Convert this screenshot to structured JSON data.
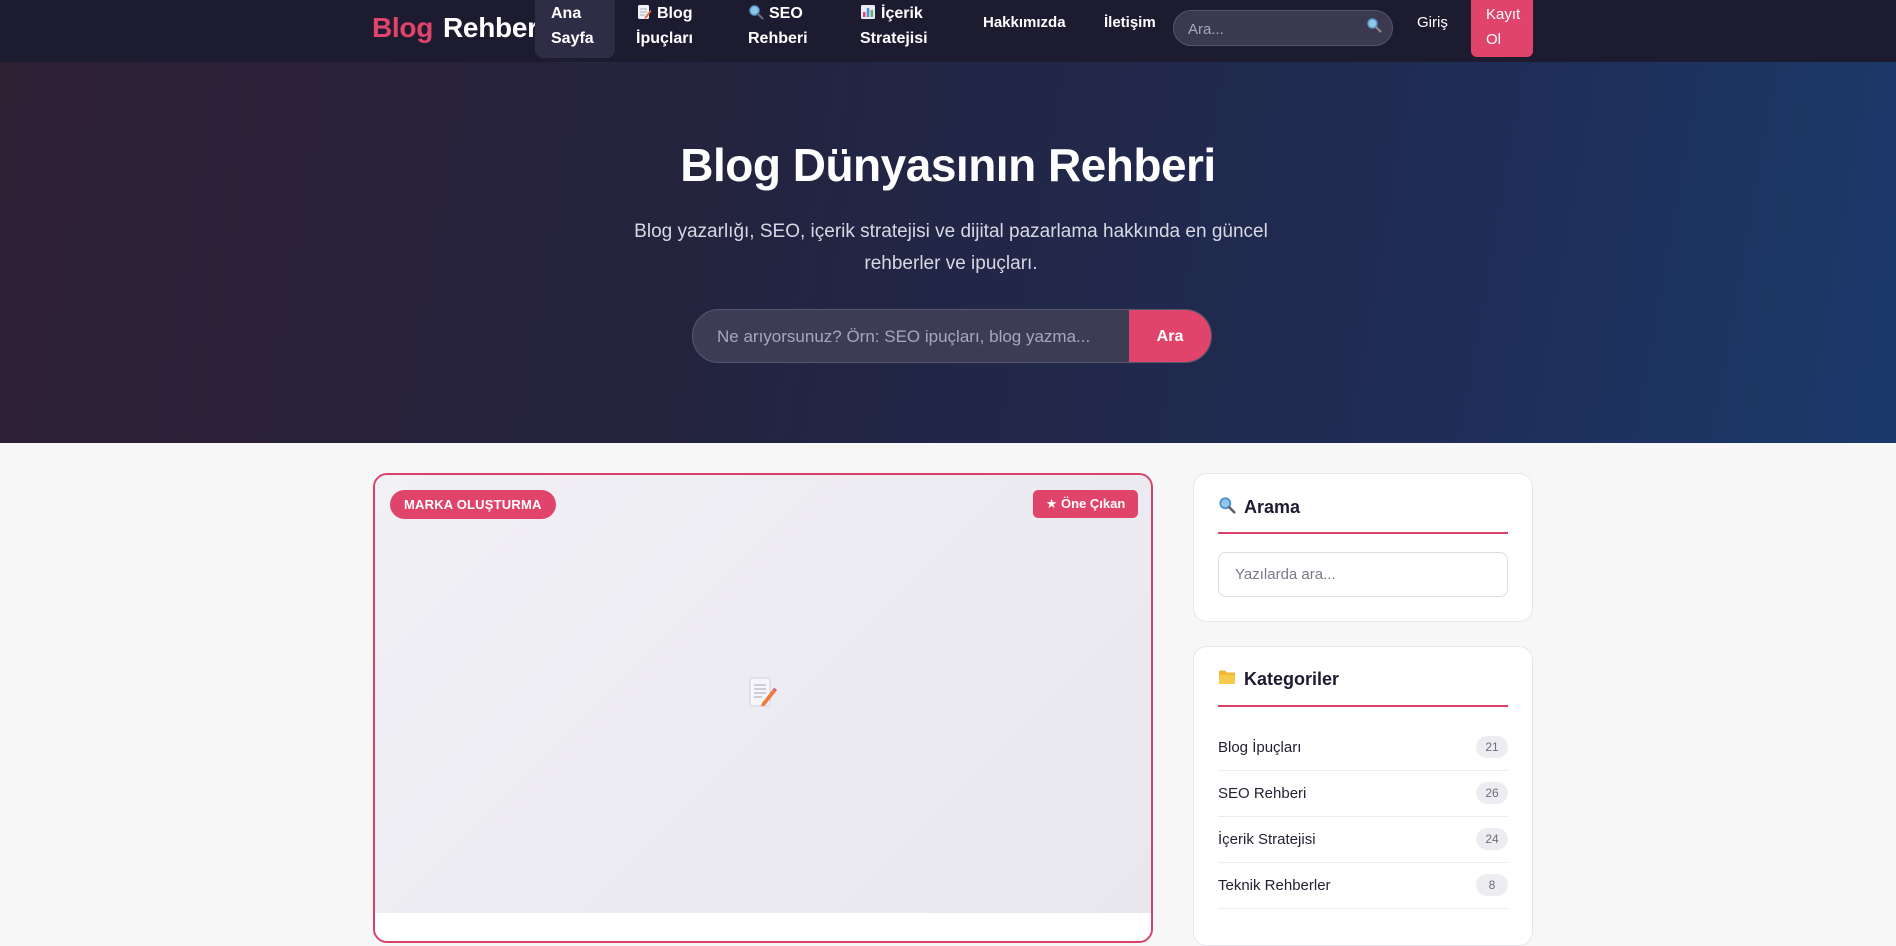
{
  "nav": {
    "logo_part1": "Blog",
    "logo_part2": "Rehberi",
    "items": [
      {
        "line1": "Ana",
        "line2": "Sayfa",
        "icon": ""
      },
      {
        "line1": "Blog",
        "line2": "İpuçları",
        "icon": "memo-icon"
      },
      {
        "line1": "SEO",
        "line2": "Rehberi",
        "icon": "magnifier-icon"
      },
      {
        "line1": "İçerik",
        "line2": "Stratejisi",
        "icon": "bar-chart-icon"
      }
    ],
    "about": "Hakkımızda",
    "contact": "İletişim",
    "search_placeholder": "Ara...",
    "login": "Giriş",
    "signup_line1": "Kayıt",
    "signup_line2": "Ol"
  },
  "hero": {
    "title": "Blog Dünyasının Rehberi",
    "subtitle": "Blog yazarlığı, SEO, içerik stratejisi ve dijital pazarlama hakkında en güncel rehberler ve ipuçları.",
    "search_placeholder": "Ne arıyorsunuz? Örn: SEO ipuçları, blog yazma...",
    "search_button": "Ara"
  },
  "featured": {
    "category": "MARKA OLUŞTURMA",
    "badge": "★ Öne Çıkan",
    "image_icon": "memo-icon"
  },
  "sidebar": {
    "search": {
      "title": "Arama",
      "icon": "magnifier-icon",
      "placeholder": "Yazılarda ara..."
    },
    "categories": {
      "title": "Kategoriler",
      "icon": "folder-icon",
      "items": [
        {
          "label": "Blog İpuçları",
          "count": "21"
        },
        {
          "label": "SEO Rehberi",
          "count": "26"
        },
        {
          "label": "İçerik Stratejisi",
          "count": "24"
        },
        {
          "label": "Teknik Rehberler",
          "count": "8"
        }
      ]
    }
  },
  "colors": {
    "accent": "#e0446a",
    "nav_bg": "#1d1b30",
    "hero_start": "#2e1f33",
    "hero_end": "#1b3a6b"
  }
}
